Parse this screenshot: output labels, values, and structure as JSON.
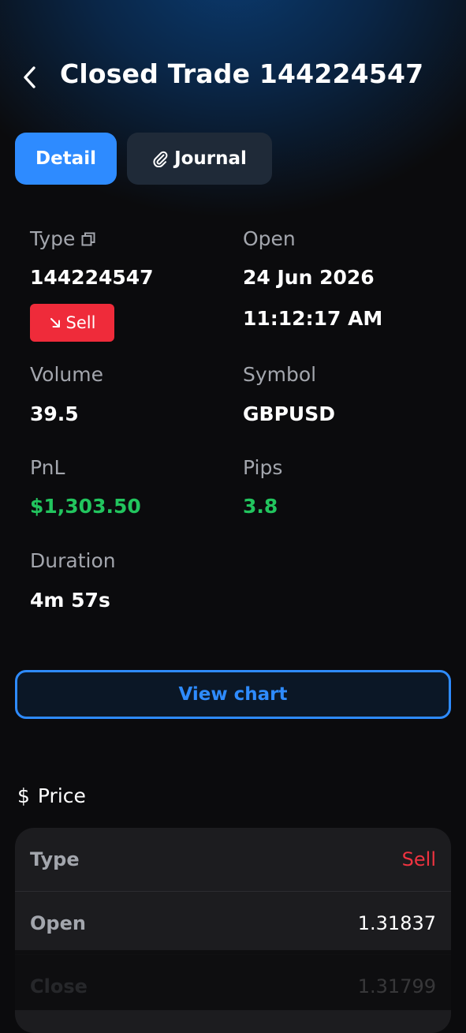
{
  "header": {
    "title": "Closed Trade 144224547"
  },
  "tabs": {
    "detail_label": "Detail",
    "journal_label": "Journal"
  },
  "details": {
    "type_label": "Type",
    "type_value": "144224547",
    "side_badge": "Sell",
    "open_label": "Open",
    "open_date": "24 Jun 2026",
    "open_time": "11:12:17 AM",
    "volume_label": "Volume",
    "volume_value": "39.5",
    "symbol_label": "Symbol",
    "symbol_value": "GBPUSD",
    "pnl_label": "PnL",
    "pnl_value": "$1,303.50",
    "pips_label": "Pips",
    "pips_value": "3.8",
    "duration_label": "Duration",
    "duration_value": "4m 57s"
  },
  "actions": {
    "view_chart_label": "View chart"
  },
  "price": {
    "section_icon": "$",
    "section_title": "Price",
    "rows": [
      {
        "label": "Type",
        "value": "Sell"
      },
      {
        "label": "Open",
        "value": "1.31837"
      },
      {
        "label": "Close",
        "value": "1.31799"
      }
    ]
  },
  "colors": {
    "accent": "#2e8bff",
    "sell": "#ef2b3a",
    "profit": "#22c55e"
  },
  "icons": {
    "back": "chevron-left-icon",
    "copy": "copy-icon",
    "attachment": "paperclip-icon",
    "sell_arrow": "arrow-down-right-icon"
  }
}
